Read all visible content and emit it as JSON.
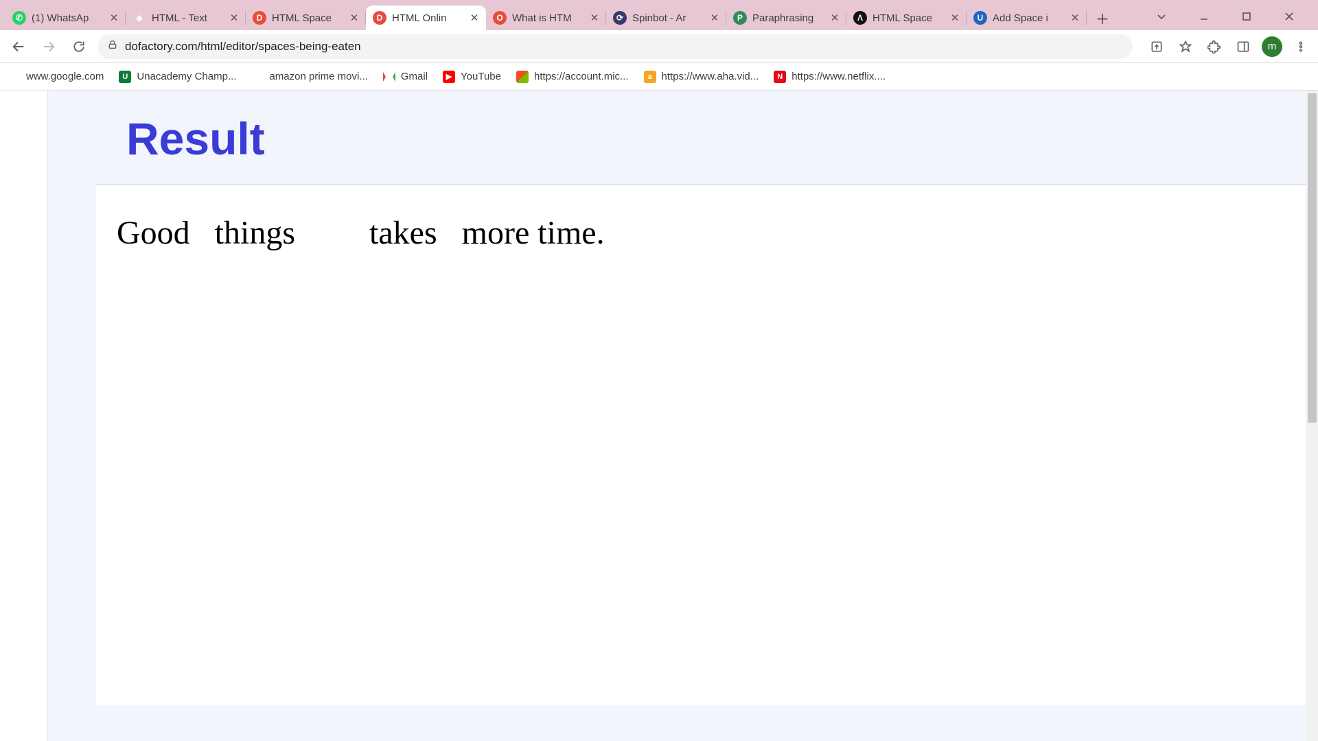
{
  "tabs": [
    {
      "title": "(1) WhatsAp"
    },
    {
      "title": "HTML - Text"
    },
    {
      "title": "HTML Space"
    },
    {
      "title": "HTML Onlin"
    },
    {
      "title": "What is HTM"
    },
    {
      "title": "Spinbot - Ar"
    },
    {
      "title": "Paraphrasing"
    },
    {
      "title": "HTML Space"
    },
    {
      "title": "Add Space i"
    }
  ],
  "active_tab_index": 3,
  "omnibox": {
    "url": "dofactory.com/html/editor/spaces-being-eaten"
  },
  "avatar_letter": "m",
  "bookmarks": [
    {
      "label": "www.google.com"
    },
    {
      "label": "Unacademy Champ..."
    },
    {
      "label": "amazon prime movi..."
    },
    {
      "label": "Gmail"
    },
    {
      "label": "YouTube"
    },
    {
      "label": "https://account.mic..."
    },
    {
      "label": "https://www.aha.vid..."
    },
    {
      "label": "https://www.netflix...."
    }
  ],
  "page": {
    "heading": "Result",
    "result_text": "Good   things         takes   more time."
  }
}
